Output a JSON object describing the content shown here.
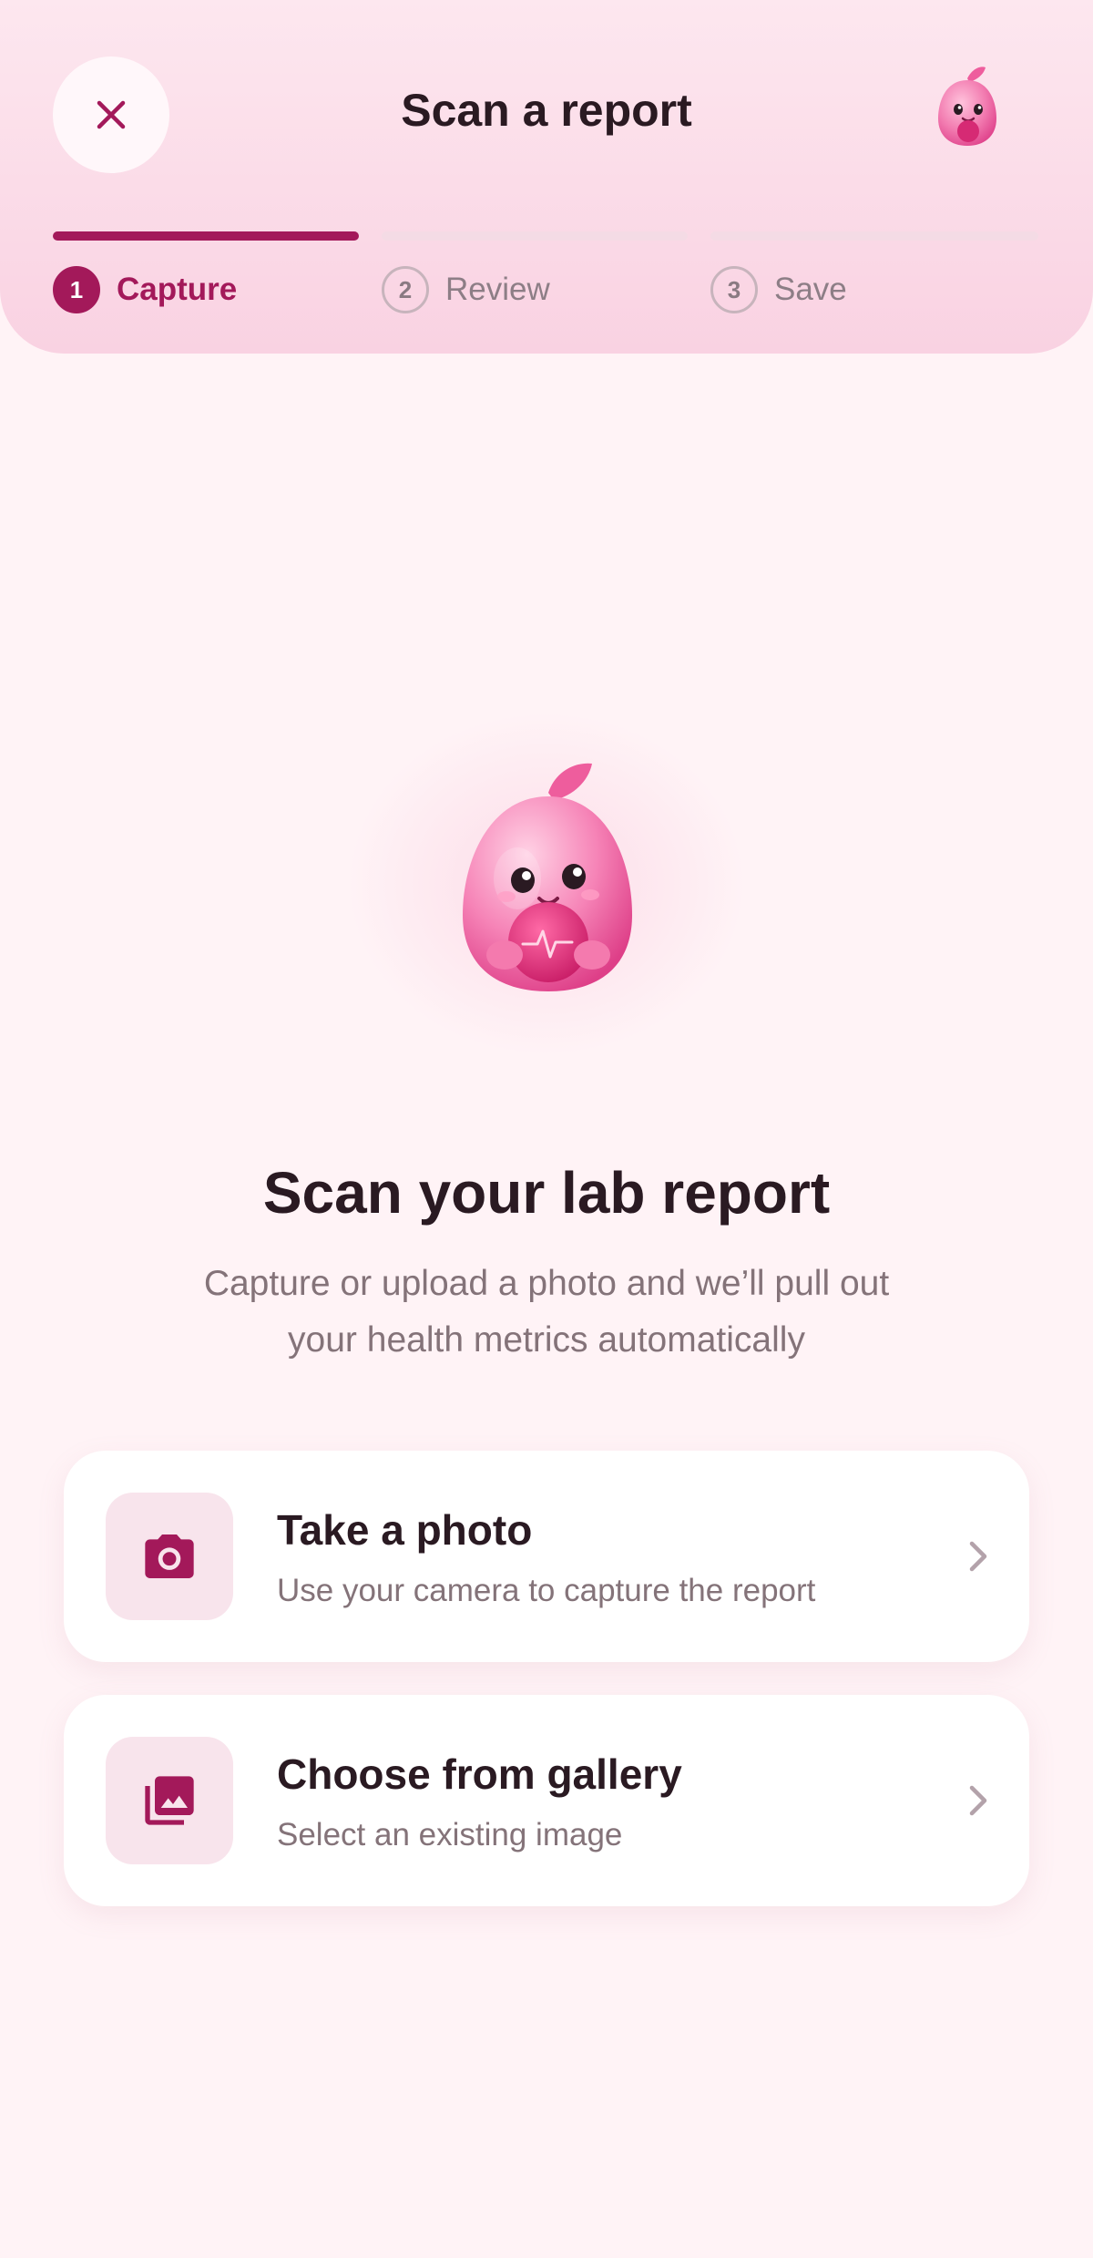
{
  "header": {
    "title": "Scan a report",
    "close_icon": "close-icon",
    "avatar_icon": "mascot-avatar"
  },
  "steps": [
    {
      "number": "1",
      "label": "Capture",
      "state": "active"
    },
    {
      "number": "2",
      "label": "Review",
      "state": "upcoming"
    },
    {
      "number": "3",
      "label": "Save",
      "state": "upcoming"
    }
  ],
  "hero": {
    "title": "Scan your lab report",
    "subtitle_line1": "Capture or upload a photo and we’ll pull out",
    "subtitle_line2": "your health metrics automatically",
    "illustration": "mascot-holding-heart"
  },
  "options": [
    {
      "title": "Take a photo",
      "subtitle": "Use your camera to capture the report",
      "icon": "camera-icon"
    },
    {
      "title": "Choose from gallery",
      "subtitle": "Select an existing image",
      "icon": "gallery-icon"
    }
  ],
  "colors": {
    "accent": "#a3195a",
    "background": "#fff3f6",
    "header_gradient_top": "#fde7ef",
    "header_gradient_bottom": "#f9d2e2",
    "icon_tile": "#f8e4ec",
    "text_primary": "#2a1a22",
    "text_secondary": "#847379"
  }
}
